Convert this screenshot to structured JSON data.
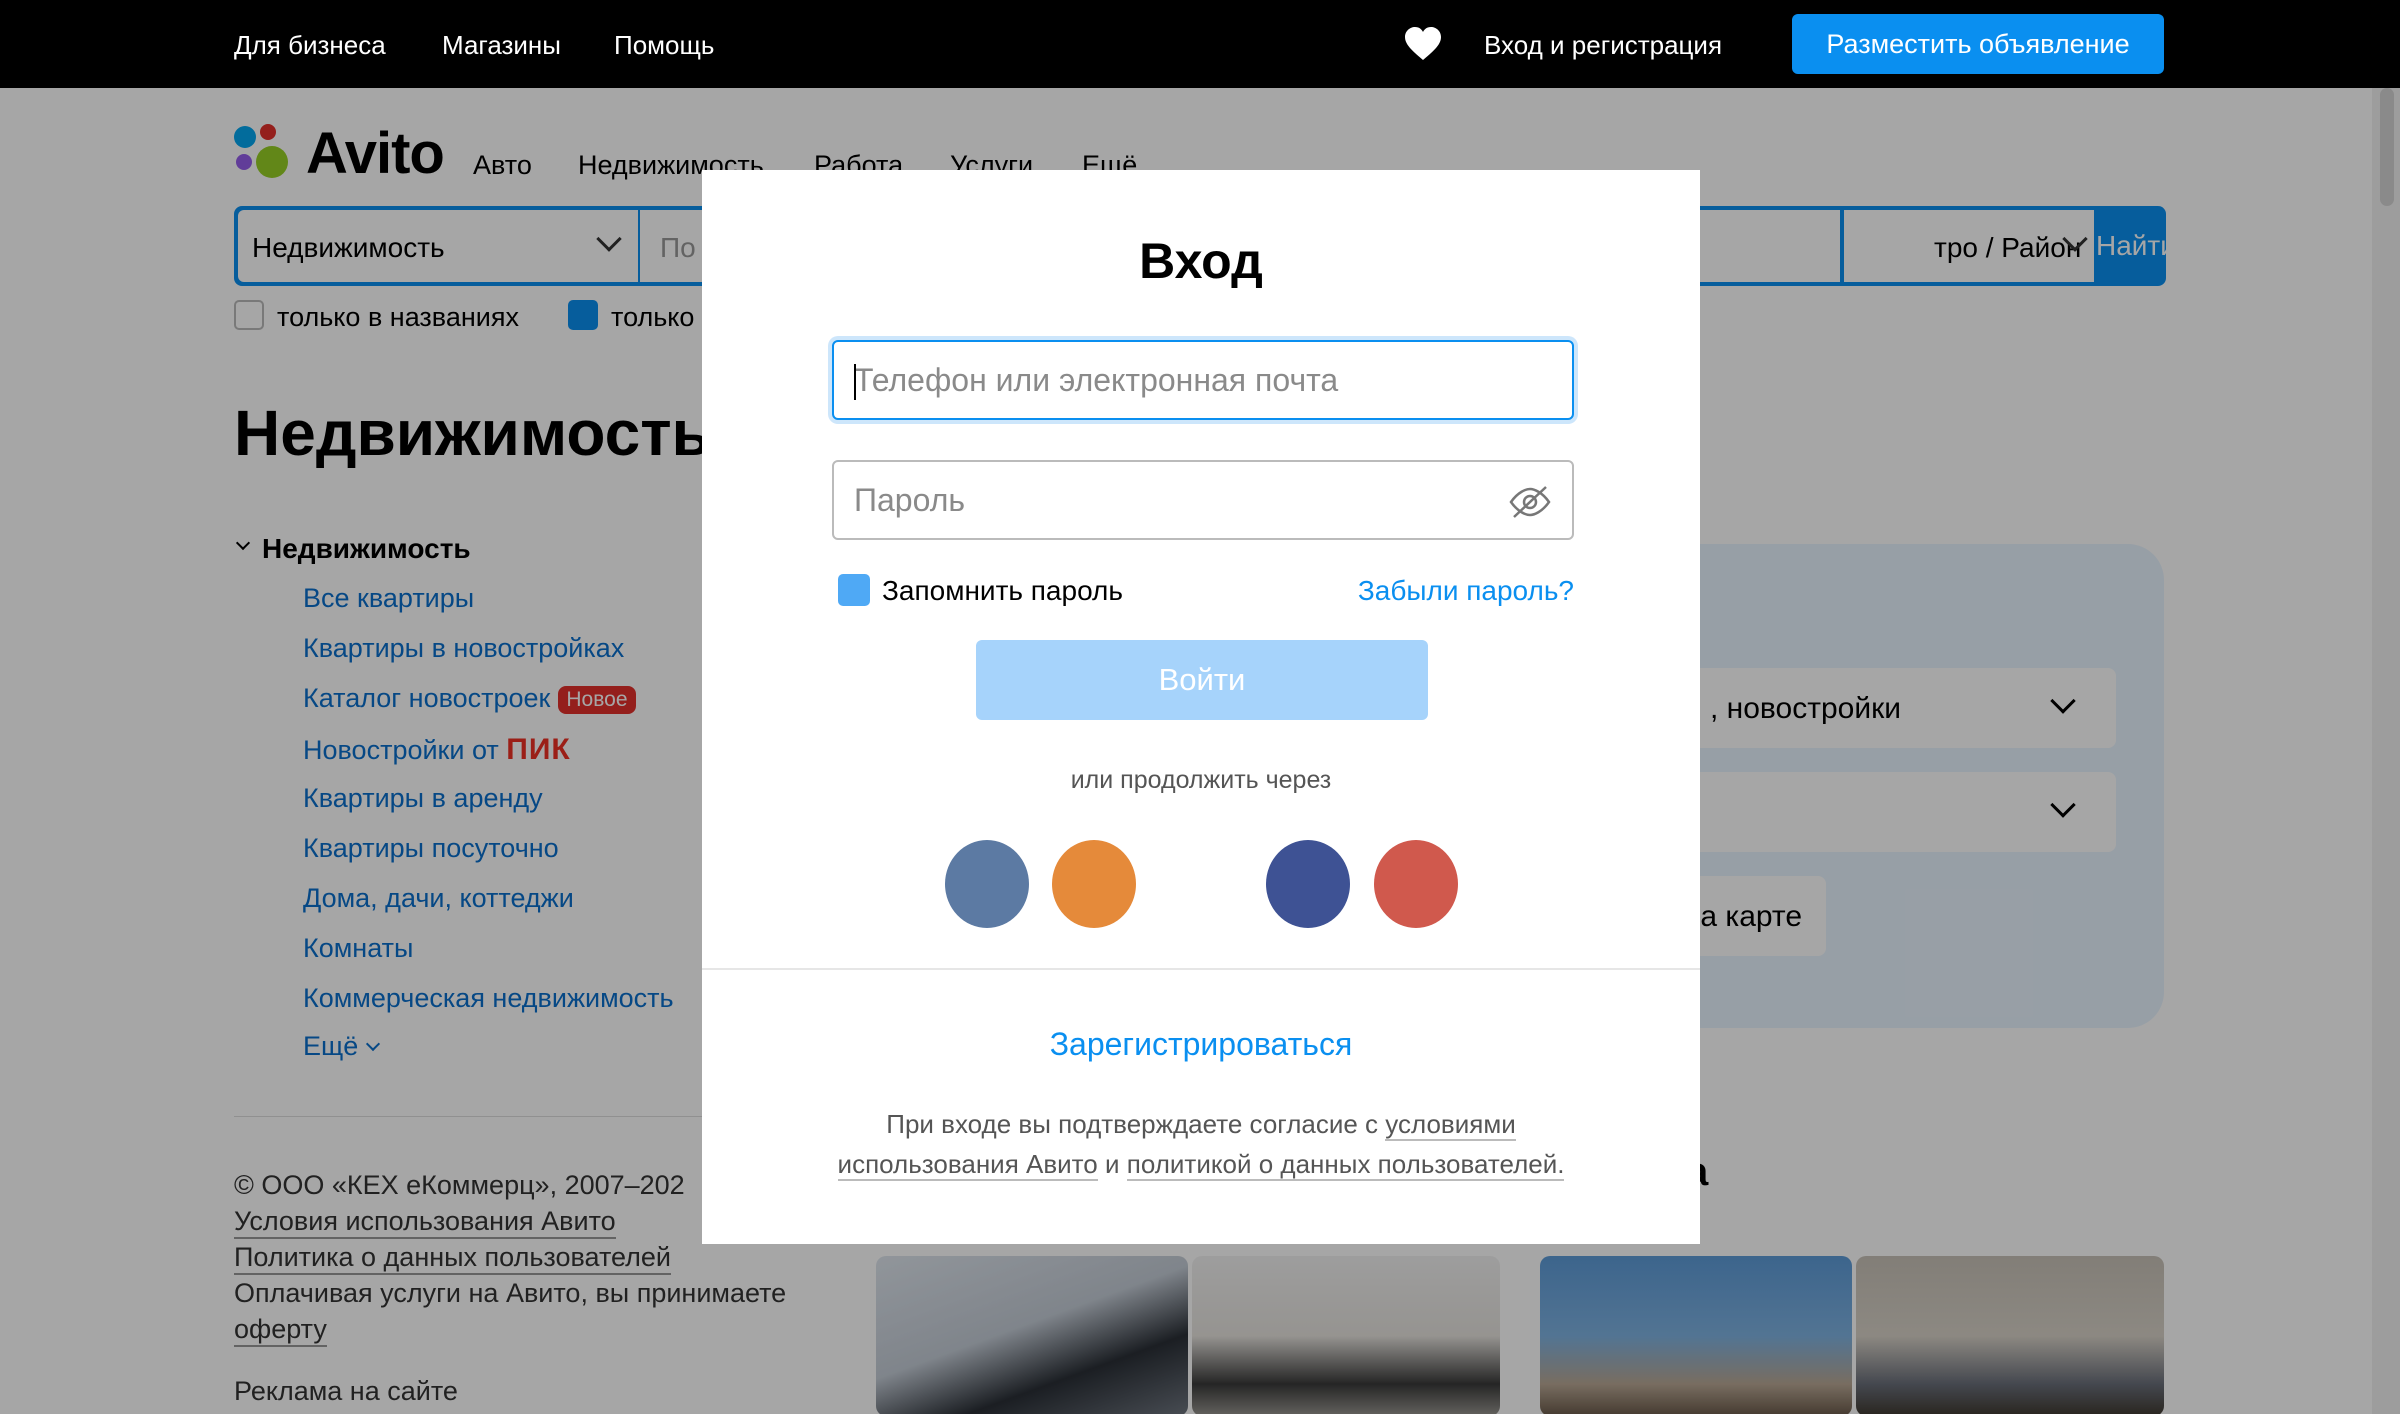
{
  "topbar": {
    "business": "Для бизнеса",
    "shops": "Магазины",
    "help": "Помощь",
    "login": "Вход и регистрация",
    "post_ad": "Разместить объявление"
  },
  "header": {
    "logo": "Avito",
    "nav": [
      "Авто",
      "Недвижимость",
      "Работа",
      "Услуги",
      "Ещё"
    ]
  },
  "search": {
    "category": "Недвижимость",
    "query_placeholder": "По",
    "metro": "тро / Район",
    "submit": "Найти",
    "only_titles": "только в названиях",
    "only_photo": "только"
  },
  "page": {
    "title": "Недвижимость",
    "category_head": "Недвижимость",
    "categories": [
      "Все квартиры",
      "Квартиры в новостройках",
      "Каталог новостроек",
      "Новостройки от",
      "Квартиры в аренду",
      "Квартиры посуточно",
      "Дома, дачи, коттеджи",
      "Комнаты",
      "Коммерческая недвижимость",
      "Ещё"
    ],
    "new_badge": "Новое",
    "pik_brand": "ПИК",
    "map_select_1": ", новостройки",
    "map_button": "на карте",
    "section_title": "ка"
  },
  "footer": {
    "copyright": "© ООО «КЕХ еКоммерц», 2007–202",
    "terms": "Условия использования Авито",
    "privacy": "Политика о данных пользователей",
    "offer_text": "Оплачивая услуги на Авито, вы принимаете",
    "offer_link": "оферту",
    "ads": "Реклама на сайте"
  },
  "modal": {
    "title": "Вход",
    "login_placeholder": "Телефон или электронная почта",
    "password_placeholder": "Пароль",
    "remember": "Запомнить пароль",
    "forgot": "Забыли пароль?",
    "submit": "Войти",
    "or_continue": "или продолжить через",
    "social": [
      {
        "name": "vk-icon",
        "color": "#5c7aa3"
      },
      {
        "name": "ok-icon",
        "color": "#e58a3a"
      },
      {
        "name": "facebook-icon",
        "color": "#3e5294"
      },
      {
        "name": "mail-icon",
        "color": "#d0594d"
      }
    ],
    "register": "Зарегистрироваться",
    "legal_prefix": "При входе вы подтверждаете согласие с",
    "legal_terms": "условиями использования Авито",
    "legal_and": "и",
    "legal_privacy": "политикой о данных пользователей."
  },
  "colors": {
    "accent": "#0a8ff0",
    "login_disabled": "#a6d3fb",
    "badge": "#e4302c"
  }
}
